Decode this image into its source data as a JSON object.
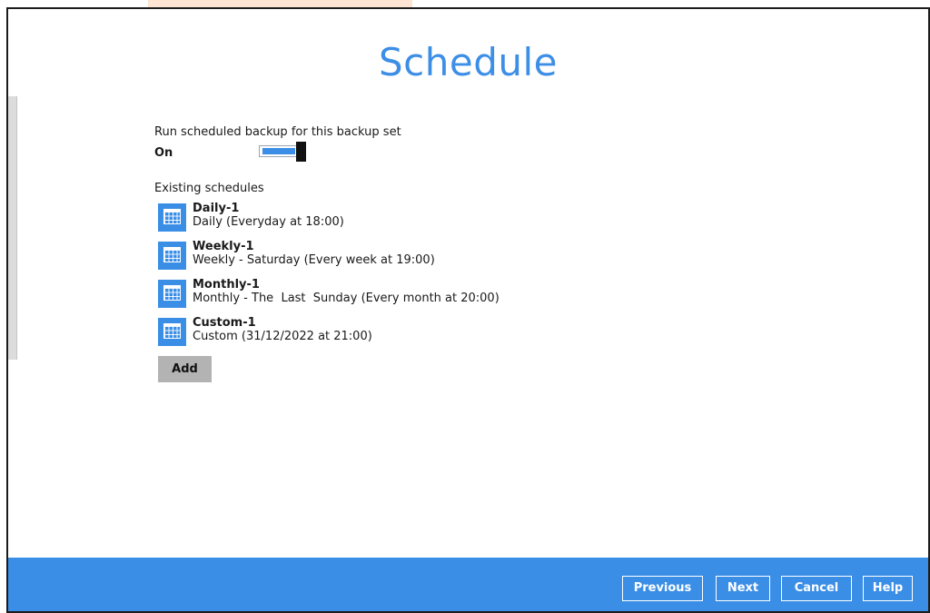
{
  "page": {
    "title": "Schedule"
  },
  "backup": {
    "run_label": "Run scheduled backup for this backup set",
    "toggle_state_label": "On",
    "toggle_on": true
  },
  "existing": {
    "label": "Existing schedules",
    "items": [
      {
        "name": "Daily-1",
        "description": "Daily (Everyday at 18:00)"
      },
      {
        "name": "Weekly-1",
        "description": "Weekly - Saturday (Every week at 19:00)"
      },
      {
        "name": "Monthly-1",
        "description": "Monthly - The  Last  Sunday (Every month at 20:00)"
      },
      {
        "name": "Custom-1",
        "description": "Custom (31/12/2022 at 21:00)"
      }
    ],
    "add_label": "Add"
  },
  "footer": {
    "previous_label": "Previous",
    "next_label": "Next",
    "cancel_label": "Cancel",
    "help_label": "Help"
  },
  "colors": {
    "accent": "#3a8ee6",
    "title": "#3d8ee6",
    "add_button": "#b3b3b3"
  }
}
